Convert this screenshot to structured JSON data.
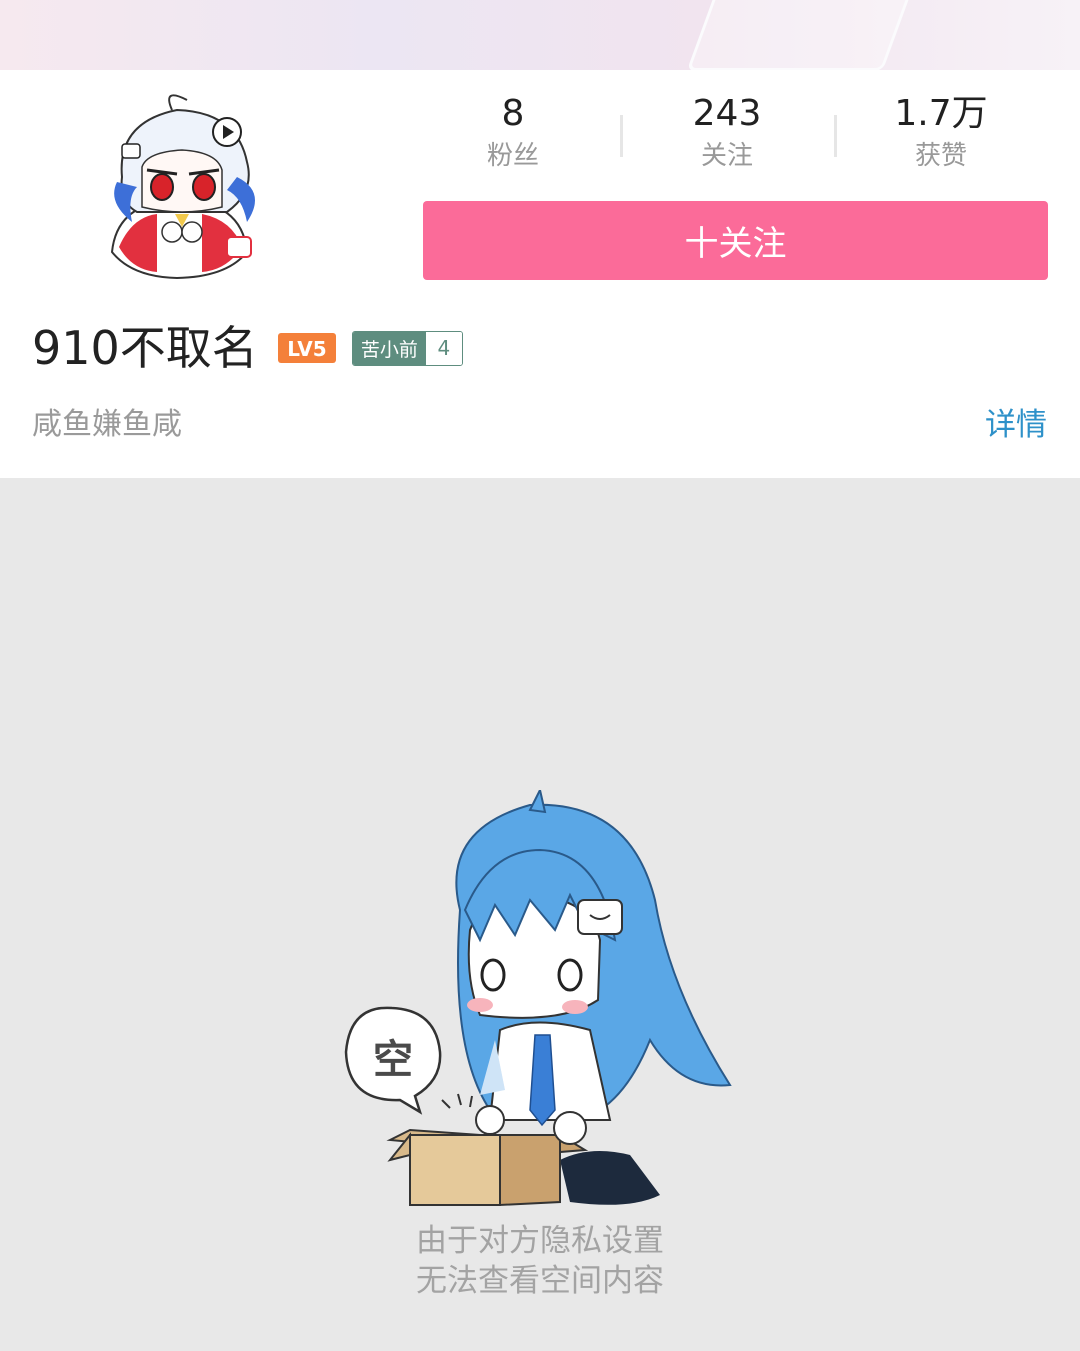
{
  "header": {
    "avatar_icon": "anime-mascot-avatar"
  },
  "stats": [
    {
      "value": "8",
      "label": "粉丝"
    },
    {
      "value": "243",
      "label": "关注"
    },
    {
      "value": "1.7万",
      "label": "获赞"
    }
  ],
  "follow_button": {
    "label": "十关注"
  },
  "user": {
    "name": "910不取名",
    "level": "LV5",
    "medal_name": "苦小前",
    "medal_level": "4",
    "signature": "咸鱼嫌鱼咸"
  },
  "detail_link": "详情",
  "empty_state": {
    "bubble_text": "空",
    "line1": "由于对方隐私设置",
    "line2": "无法查看空间内容"
  },
  "colors": {
    "accent_pink": "#fb6b99",
    "link_blue": "#2e91c9",
    "level_orange": "#f4803a",
    "medal_green": "#5e8d7f",
    "page_gray": "#e8e8e8"
  }
}
